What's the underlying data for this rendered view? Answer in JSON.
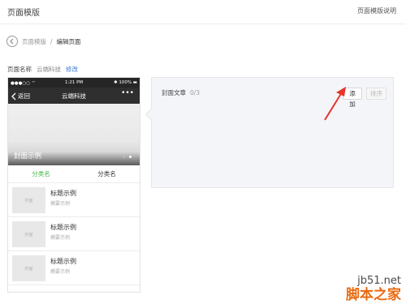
{
  "header": {
    "title": "页面模版",
    "help_link": "页面模版说明"
  },
  "breadcrumb": {
    "parent": "页面模版",
    "separator": "/",
    "current": "编辑页面"
  },
  "page_name": {
    "label": "页面名称",
    "value": "云端科技",
    "edit_link": "修改"
  },
  "phone": {
    "status": {
      "carrier": "●●●○○ ⌔",
      "time": "1:21 PM",
      "battery": "✱ 100% ▬"
    },
    "nav": {
      "back": "返回",
      "title": "云端科技",
      "more": "•••"
    },
    "cover": {
      "caption": "封面示例"
    },
    "tabs": [
      {
        "label": "分类名",
        "active": true
      },
      {
        "label": "分类名",
        "active": false
      }
    ],
    "articles": [
      {
        "thumb": "封面",
        "title": "标题示例",
        "summary": "摘要示例"
      },
      {
        "thumb": "封面",
        "title": "标题示例",
        "summary": "摘要示例"
      },
      {
        "thumb": "封面",
        "title": "标题示例",
        "summary": "摘要示例"
      }
    ]
  },
  "panel": {
    "label": "封面文章",
    "count": "0/3",
    "add_button": "添加",
    "sort_button": "排序"
  },
  "watermark": {
    "url": "jb51.net",
    "brand": "脚本之家"
  },
  "colors": {
    "active_tab": "#44b549",
    "link": "#3a7bd5",
    "annotation_arrow": "#e8332b",
    "watermark_brand": "#ea6a10"
  }
}
